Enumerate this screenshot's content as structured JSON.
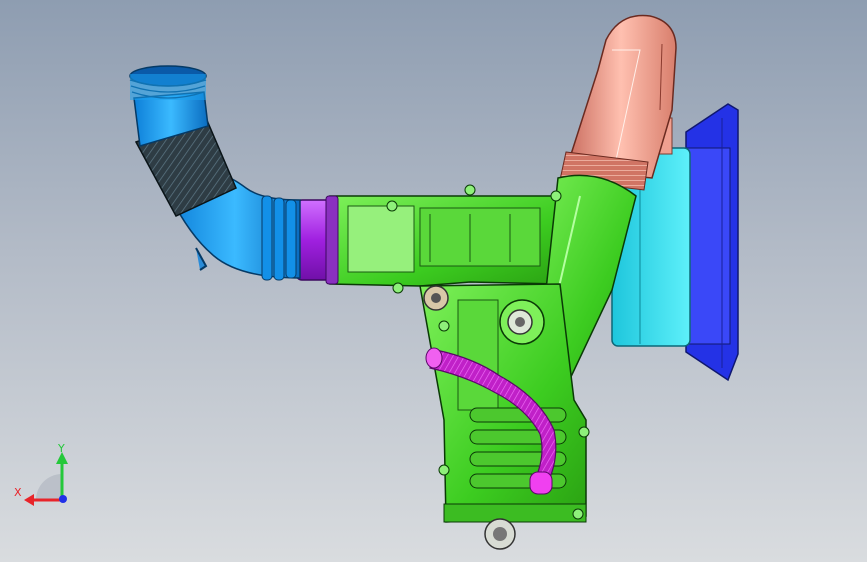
{
  "viewport": {
    "background_top": "#8e9db1",
    "background_bottom": "#d9dcdf"
  },
  "colors": {
    "hose_blue": "#1aa0f0",
    "hose_dark": "#2b3a42",
    "coupling_purple": "#b23cf0",
    "housing_green": "#4cd62a",
    "housing_light": "#8ef07a",
    "pipe_salmon": "#f0a090",
    "cooler_cyan": "#2ad8e8",
    "cooler_blue": "#2a36f0",
    "breather_magenta": "#e030e8",
    "axis_x": "#e8242a",
    "axis_y": "#24c83a",
    "axis_z": "#2030e8"
  },
  "triad": {
    "x_label": "X",
    "y_label": "Y"
  }
}
